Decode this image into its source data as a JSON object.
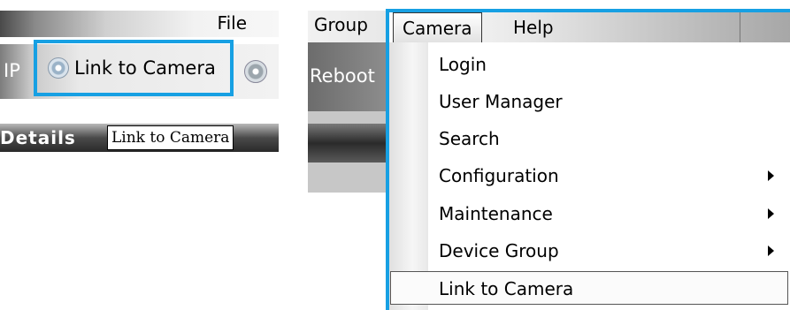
{
  "left_toolbar": {
    "file_label": "File",
    "ip_label": "IP",
    "link_button_label": "Link to Camera",
    "details_label": "Details",
    "tooltip": "Link to Camera"
  },
  "right_toolbar": {
    "group_label": "Group",
    "reboot_label": "Reboot"
  },
  "menubar": {
    "camera_label": "Camera",
    "help_label": "Help"
  },
  "camera_menu": {
    "items": [
      {
        "label": "Login",
        "has_submenu": false
      },
      {
        "label": "User Manager",
        "has_submenu": false
      },
      {
        "label": "Search",
        "has_submenu": false
      },
      {
        "label": "Configuration",
        "has_submenu": true
      },
      {
        "label": "Maintenance",
        "has_submenu": true
      },
      {
        "label": "Device Group",
        "has_submenu": true
      },
      {
        "label": "Link to Camera",
        "has_submenu": false
      }
    ]
  },
  "colors": {
    "highlight_border": "#17a0e3"
  }
}
